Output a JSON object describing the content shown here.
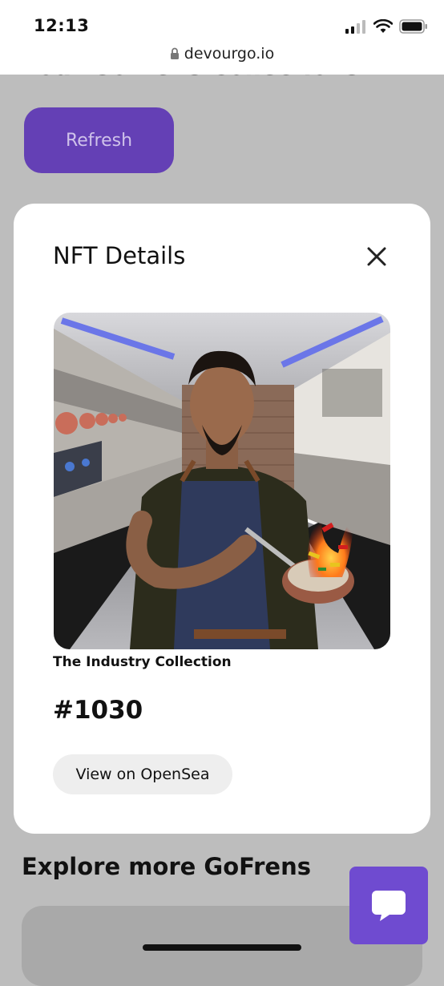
{
  "status_bar": {
    "time": "12:13",
    "signal_icon": "cellular-signal-icon",
    "wifi_icon": "wifi-icon",
    "battery_icon": "battery-icon"
  },
  "browser": {
    "url": "devourgo.io",
    "lock_icon": "lock-icon"
  },
  "page": {
    "section_title": "Your GoFrens Collections",
    "refresh_label": "Refresh",
    "explore_title": "Explore more GoFrens"
  },
  "modal": {
    "title": "NFT Details",
    "close_icon": "close-icon",
    "image_alt": "NFT artwork: chef in apron tossing peppers in a pan in a commercial kitchen",
    "collection": "The Industry Collection",
    "token": "#1030",
    "opensea_label": "View on OpenSea"
  },
  "chat": {
    "icon": "chat-bubble-icon"
  },
  "colors": {
    "accent": "#6440b5",
    "chat": "#6f4bd0",
    "backdrop": "#bdbdbd"
  }
}
